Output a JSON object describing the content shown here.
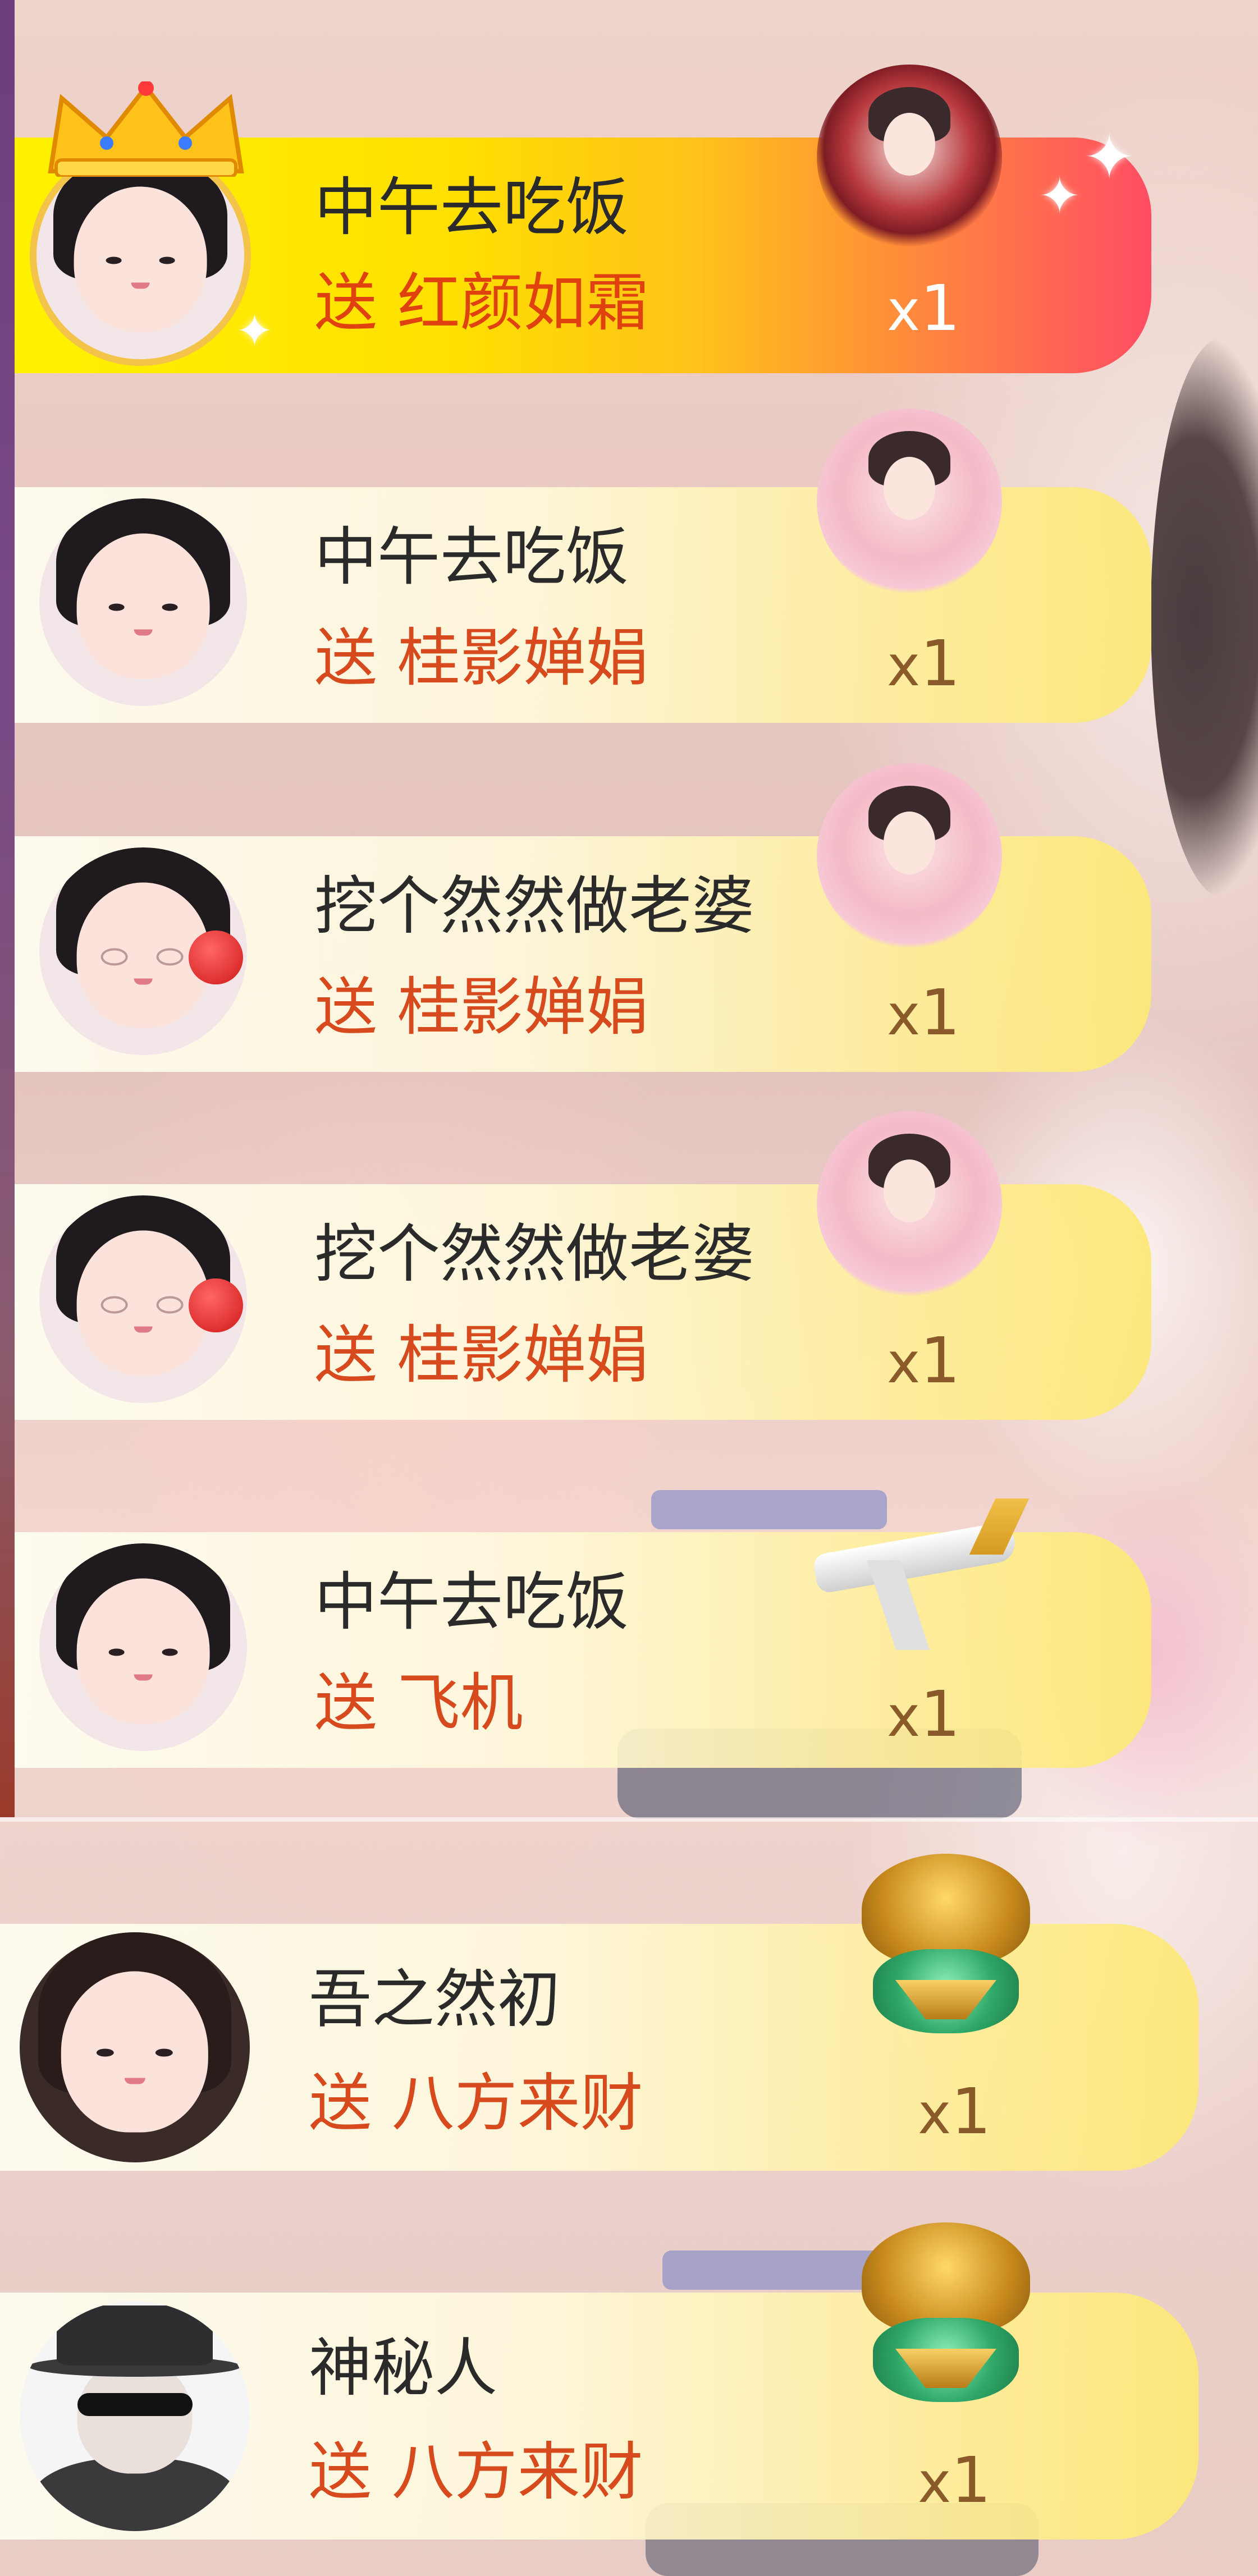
{
  "gifts": [
    {
      "user": "中午去吃饭",
      "gift_label": "送 红颜如霜",
      "count_x": "x",
      "count_n": "1",
      "avatar_icon": "girl-avatar-crowned",
      "gift_icon": "portrait-gift",
      "highlighted": true,
      "colors": {
        "bar_start": "#fff200",
        "bar_end": "#ff4d63"
      }
    },
    {
      "user": "中午去吃饭",
      "gift_label": "送 桂影婵娟",
      "count_x": "x",
      "count_n": "1",
      "avatar_icon": "girl-avatar",
      "gift_icon": "portrait-gift"
    },
    {
      "user": "挖个然然做老婆",
      "gift_label": "送 桂影婵娟",
      "count_x": "x",
      "count_n": "1",
      "avatar_icon": "glasses-girl-avatar",
      "gift_icon": "portrait-gift"
    },
    {
      "user": "挖个然然做老婆",
      "gift_label": "送 桂影婵娟",
      "count_x": "x",
      "count_n": "1",
      "avatar_icon": "glasses-girl-avatar",
      "gift_icon": "portrait-gift"
    },
    {
      "user": "中午去吃饭",
      "gift_label": "送 飞机",
      "count_x": "x",
      "count_n": "1",
      "avatar_icon": "girl-avatar",
      "gift_icon": "airplane-gift"
    },
    {
      "user": "吾之然初",
      "gift_label": "送 八方来财",
      "count_x": "x",
      "count_n": "1",
      "avatar_icon": "girl-avatar",
      "gift_icon": "treasure-pot-gift"
    },
    {
      "user": "神秘人",
      "gift_label": "送 八方来财",
      "count_x": "x",
      "count_n": "1",
      "avatar_icon": "mystery-person-avatar",
      "gift_icon": "treasure-pot-gift"
    }
  ]
}
